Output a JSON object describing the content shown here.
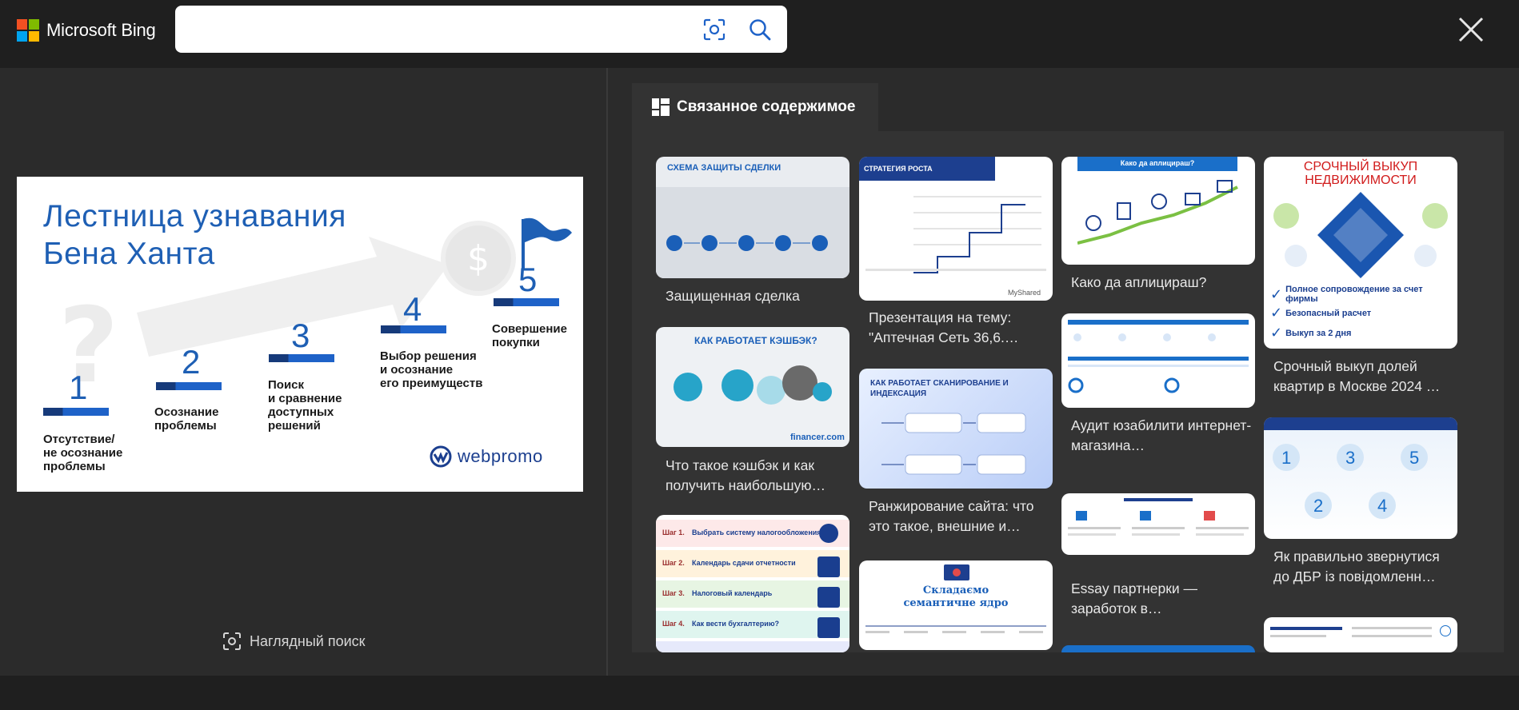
{
  "header": {
    "brand": "Microsoft Bing",
    "search_value": "",
    "search_placeholder": "",
    "brand_colors": [
      "#f25022",
      "#7fba00",
      "#00a4ef",
      "#ffb900"
    ]
  },
  "main_image": {
    "title_line1": "Лестница узнавания",
    "title_line2": "Бена Ханта",
    "steps": [
      {
        "num": "1",
        "label_lines": [
          "Отсутствие/",
          "не осознание",
          "проблемы"
        ]
      },
      {
        "num": "2",
        "label_lines": [
          "Осознание",
          "проблемы"
        ]
      },
      {
        "num": "3",
        "label_lines": [
          "Поиск",
          "и сравнение",
          "доступных",
          "решений"
        ]
      },
      {
        "num": "4",
        "label_lines": [
          "Выбор решения",
          "и осознание",
          "его преимуществ"
        ]
      },
      {
        "num": "5",
        "label_lines": [
          "Совершение",
          "покупки"
        ]
      }
    ],
    "brand_logo_text": "webpromo",
    "coin_symbol": "$",
    "question_symbol": "?"
  },
  "visual_search": {
    "label": "Наглядный поиск"
  },
  "related": {
    "tab_label": "Связанное содержимое",
    "cards": [
      {
        "caption": "Защищенная сделка",
        "thumb_title": "СХЕМА ЗАЩИТЫ СДЕЛКИ"
      },
      {
        "caption": "Что такое кэшбэк и как получить наибольшую…",
        "thumb_title": "КАК РАБОТАЕТ КЭШБЭК?",
        "thumb_footer": "financer.com"
      },
      {
        "caption": "",
        "thumb_rows": [
          "Шаг 1.",
          "Шаг 2.",
          "Шаг 3.",
          "Шаг 4."
        ],
        "thumb_row_texts": [
          "Выбрать систему налогообложения",
          "Календарь сдачи отчетности",
          "Налоговый календарь",
          "Как вести бухгалтерию?"
        ]
      },
      {
        "caption": "Презентация на тему: \"Аптечная Сеть 36,6.…",
        "thumb_title": "СТРАТЕГИЯ РОСТА",
        "thumb_footer": "MyShared"
      },
      {
        "caption": "Ранжирование сайта: что это такое, внешние и…",
        "thumb_title": "КАК РАБОТАЕТ СКАНИРОВАНИЕ И ИНДЕКСАЦИЯ"
      },
      {
        "caption": "",
        "thumb_title": "Складаємо семантичне ядро"
      },
      {
        "caption": "Како да аплицираш?",
        "thumb_title": "Како да аплицираш?"
      },
      {
        "caption": "Аудит юзабилити интернет-магазина…"
      },
      {
        "caption": "Essay партнерки — заработок в…"
      },
      {
        "caption": "Срочный выкуп долей квартир в Москве 2024 …",
        "thumb_title": "СРОЧНЫЙ ВЫКУП НЕДВИЖИМОСТИ",
        "thumb_lines": [
          "Полное сопровождение за счет фирмы",
          "Безопасный расчет",
          "Выкуп за 2 дня"
        ]
      },
      {
        "caption": "Як правильно звернутися до ДБР із повідомленн…"
      }
    ]
  }
}
